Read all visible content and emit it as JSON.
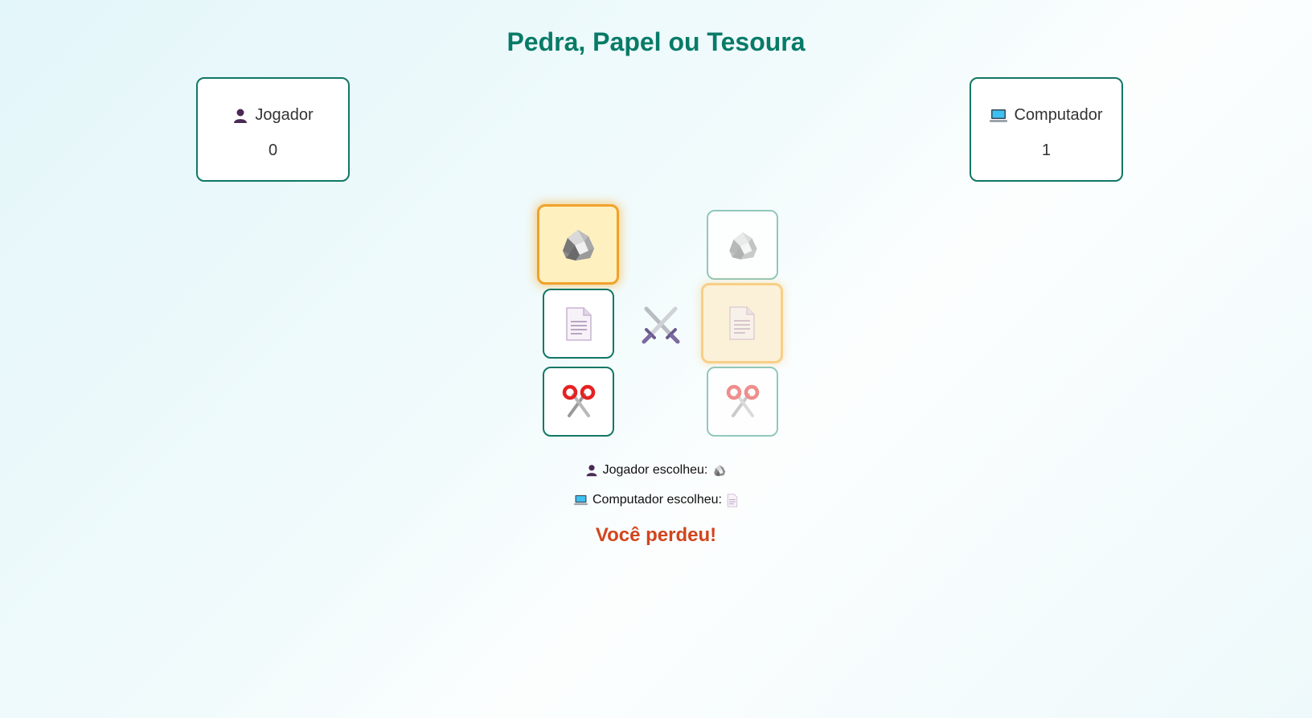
{
  "title": "Pedra, Papel ou Tesoura",
  "player": {
    "label": "Jogador",
    "score": "0",
    "icon": "person-icon",
    "chose_label": "Jogador escolheu:",
    "choice": "pedra"
  },
  "computer": {
    "label": "Computador",
    "score": "1",
    "icon": "computer-icon",
    "chose_label": "Computador escolheu:",
    "choice": "papel"
  },
  "choices": [
    {
      "id": "pedra",
      "icon": "rock-icon"
    },
    {
      "id": "papel",
      "icon": "page-icon"
    },
    {
      "id": "tesoura",
      "icon": "scissors-icon"
    }
  ],
  "vs_icon": "crossed-swords-icon",
  "outcome": "Você perdeu!",
  "colors": {
    "accent": "#087b68",
    "border": "#117766",
    "highlight": "#f0a22a",
    "lose": "#d2451c"
  }
}
